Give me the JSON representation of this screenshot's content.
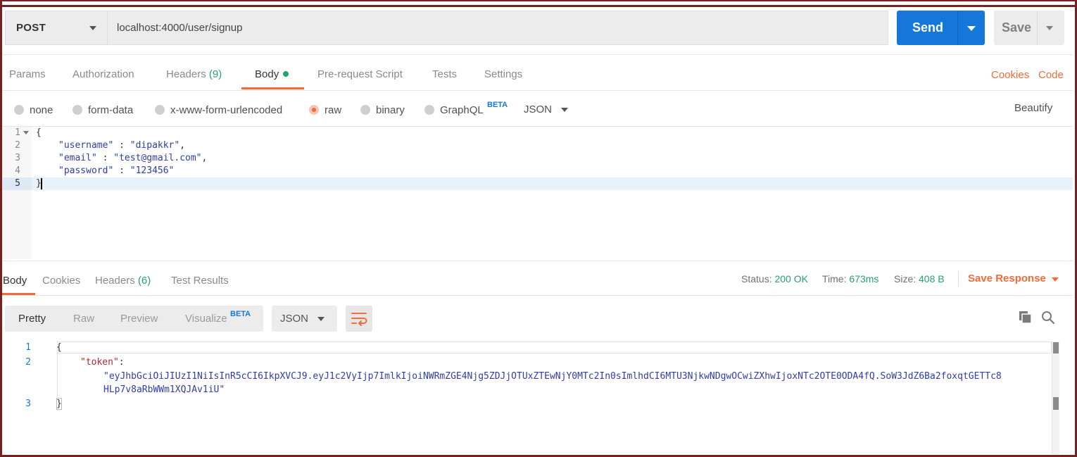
{
  "request": {
    "method": "POST",
    "url": "localhost:4000/user/signup",
    "send_label": "Send",
    "save_label": "Save"
  },
  "request_tabs": {
    "params": "Params",
    "authorization": "Authorization",
    "headers": "Headers",
    "headers_count": "(9)",
    "body": "Body",
    "prerequest": "Pre-request Script",
    "tests": "Tests",
    "settings": "Settings",
    "cookies": "Cookies",
    "code": "Code"
  },
  "body_types": {
    "none": "none",
    "form_data": "form-data",
    "urlencoded": "x-www-form-urlencoded",
    "raw": "raw",
    "binary": "binary",
    "graphql": "GraphQL",
    "beta": "BETA",
    "format": "JSON",
    "beautify": "Beautify",
    "selected": "raw"
  },
  "request_body": {
    "line_numbers": [
      "1",
      "2",
      "3",
      "4",
      "5"
    ],
    "open": "{",
    "close": "}",
    "fields": [
      {
        "key": "\"username\"",
        "sep": " : ",
        "value": "\"dipakkr\"",
        "tail": ","
      },
      {
        "key": "\"email\"",
        "sep": " : ",
        "value": "\"test@gmail.com\"",
        "tail": ","
      },
      {
        "key": "\"password\"",
        "sep": " : ",
        "value": "\"123456\"",
        "tail": ""
      }
    ]
  },
  "response_tabs": {
    "body": "Body",
    "cookies": "Cookies",
    "headers": "Headers",
    "headers_count": "(6)",
    "test_results": "Test Results"
  },
  "response_meta": {
    "status_label": "Status:",
    "status_value": "200 OK",
    "time_label": "Time:",
    "time_value": "673ms",
    "size_label": "Size:",
    "size_value": "408 B",
    "save_response": "Save Response"
  },
  "response_view": {
    "pretty": "Pretty",
    "raw": "Raw",
    "preview": "Preview",
    "visualize": "Visualize",
    "beta": "BETA",
    "format": "JSON"
  },
  "response_body": {
    "line_numbers": [
      "1",
      "2",
      "3"
    ],
    "open": "{",
    "close": "}",
    "token_key": "\"token\"",
    "token_colon": ":",
    "token_line1": "\"eyJhbGciOiJIUzI1NiIsInR5cCI6IkpXVCJ9.eyJ1c2VyIjp7ImlkIjoiNWRmZGE4Njg5ZDJjOTUxZTEwNjY0MTc2In0sImlhdCI6MTU3NjkwNDgwOCwiZXhwIjoxNTc2OTE0ODA4fQ.SoW3JdZ6Ba2foxqtGETTc8",
    "token_line2": "HLp7v8aRbWWm1XQJAv1iU\""
  },
  "colors": {
    "accent": "#f26b3a",
    "send": "#1477d9",
    "success": "#26a26b",
    "frame": "#7a1f1f"
  }
}
